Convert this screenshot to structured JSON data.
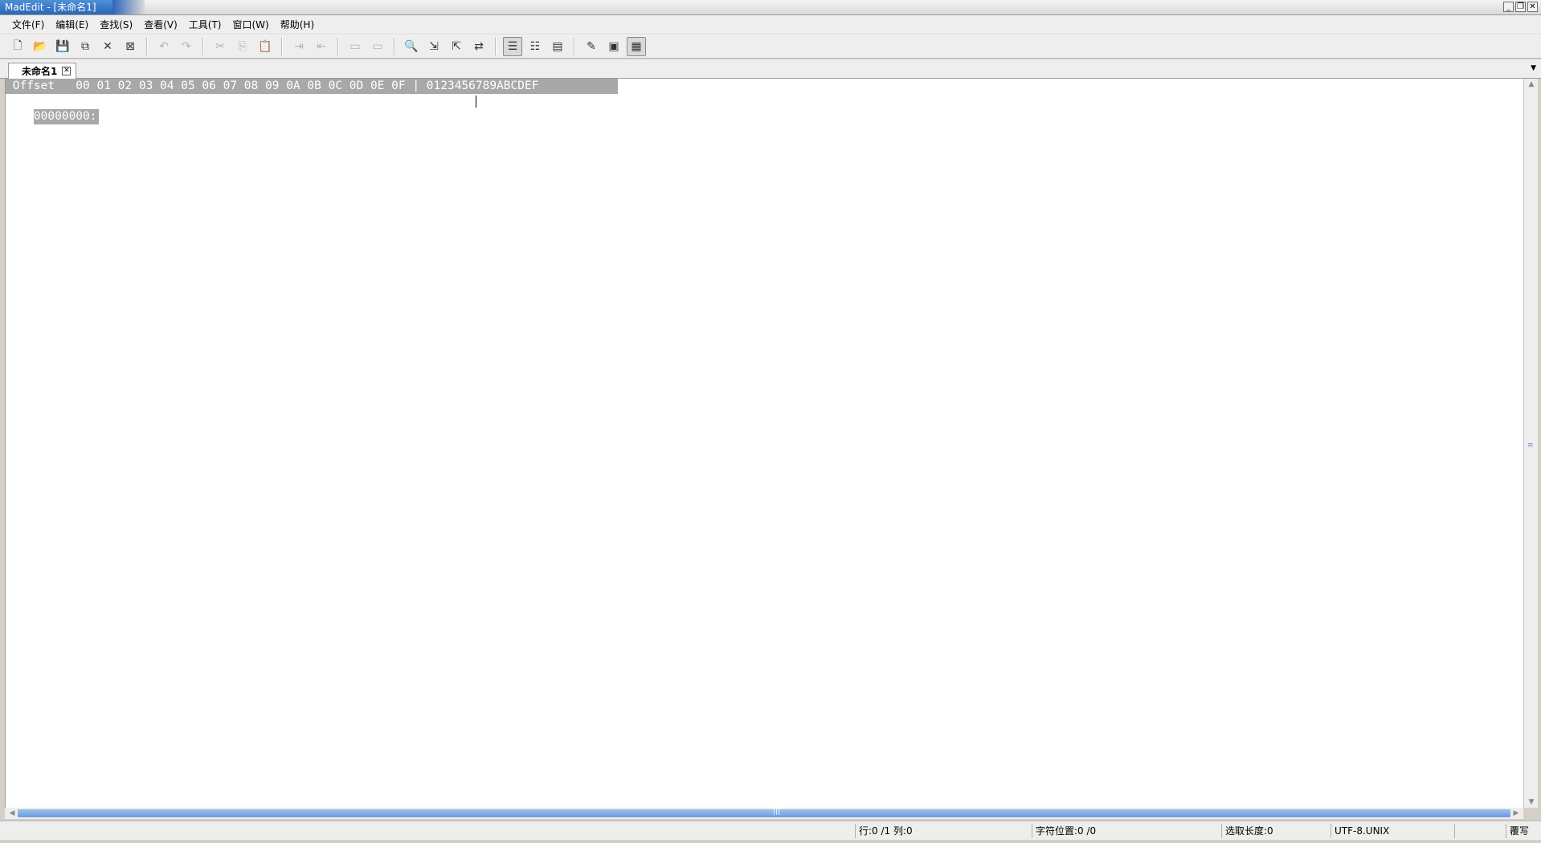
{
  "window": {
    "title": "MadEdit - [未命名1]",
    "buttons": [
      "minimize-icon",
      "restore-icon",
      "close-icon"
    ]
  },
  "menu": [
    {
      "label": "文件(F)"
    },
    {
      "label": "编辑(E)"
    },
    {
      "label": "查找(S)"
    },
    {
      "label": "查看(V)"
    },
    {
      "label": "工具(T)"
    },
    {
      "label": "窗口(W)"
    },
    {
      "label": "帮助(H)"
    }
  ],
  "toolbar": {
    "groups": [
      [
        "new-file-icon",
        "open-file-icon",
        "save-icon",
        "save-all-icon",
        "close-file-icon",
        "close-all-icon"
      ],
      [
        "undo-icon",
        "redo-icon"
      ],
      [
        "cut-icon",
        "copy-icon",
        "paste-icon"
      ],
      [
        "indent-icon",
        "unindent-icon"
      ],
      [
        "comment-icon",
        "uncomment-icon"
      ],
      [
        "find-icon",
        "find-next-icon",
        "find-previous-icon",
        "replace-icon"
      ],
      [
        "text-mode-icon",
        "column-mode-icon",
        "hex-mode-view-icon"
      ],
      [
        "options-icon",
        "print-preview-icon",
        "hex-mode-icon"
      ]
    ]
  },
  "tabs": {
    "active": {
      "label": "未命名1"
    }
  },
  "editor": {
    "header": " Offset   00 01 02 03 04 05 06 07 08 09 0A 0B 0C 0D 0E 0F | 0123456789ABCDEF",
    "rows": [
      {
        "offset": "00000000:"
      }
    ]
  },
  "status": {
    "line_col": "行:0 /1 列:0",
    "char_pos": "字符位置:0 /0",
    "sel_len": "选取长度:0",
    "encoding": "UTF-8.UNIX",
    "mode": "",
    "insert_mode": "覆写"
  }
}
